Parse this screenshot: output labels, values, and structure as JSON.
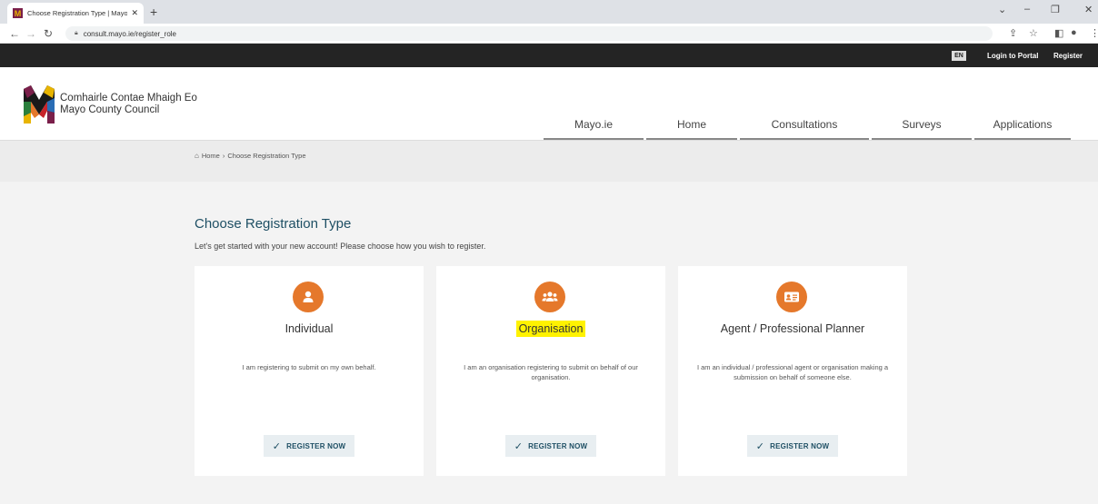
{
  "browser": {
    "tab_title": "Choose Registration Type | Mayo",
    "tab_close": "✕",
    "new_tab": "+",
    "url": "consult.mayo.ie/register_role",
    "controls": {
      "minimize": "–",
      "restore": "❐",
      "close": "✕",
      "chevron": "⌄"
    }
  },
  "topbar": {
    "lang": "EN",
    "login": "Login to Portal",
    "register": "Register"
  },
  "header": {
    "brand_line1": "Comhairle Contae Mhaigh Eo",
    "brand_line2": "Mayo County Council",
    "nav": [
      "Mayo.ie",
      "Home",
      "Consultations",
      "Surveys",
      "Applications"
    ]
  },
  "breadcrumb": {
    "home": "Home",
    "sep": "›",
    "current": "Choose Registration Type"
  },
  "main": {
    "title": "Choose Registration Type",
    "subtitle": "Let's get started with your new account! Please choose how you wish to register.",
    "cards": [
      {
        "title": "Individual",
        "desc": "I am registering to submit on my own behalf.",
        "button": "REGISTER NOW",
        "icon": "user-icon"
      },
      {
        "title": "Organisation",
        "desc": "I am an organisation registering to submit on behalf of our organisation.",
        "button": "REGISTER NOW",
        "icon": "group-icon"
      },
      {
        "title": "Agent / Professional Planner",
        "desc": "I am an individual / professional agent or organisation making a submission on behalf of someone else.",
        "button": "REGISTER NOW",
        "icon": "id-card-icon"
      }
    ]
  },
  "colors": {
    "accent": "#e5782b",
    "heading": "#1e4f64",
    "highlight": "#fff200"
  }
}
